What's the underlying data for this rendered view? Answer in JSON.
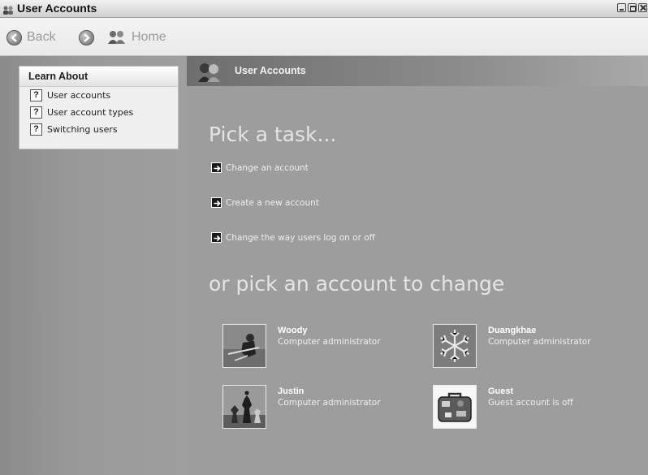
{
  "window": {
    "title": "User Accounts"
  },
  "toolbar": {
    "back_label": "Back",
    "home_label": "Home"
  },
  "learn_about": {
    "heading": "Learn About",
    "items": [
      {
        "label": "User accounts"
      },
      {
        "label": "User account types"
      },
      {
        "label": "Switching users"
      }
    ]
  },
  "main": {
    "header_title": "User Accounts",
    "pick_task_heading": "Pick a task...",
    "tasks": [
      {
        "label": "Change an account"
      },
      {
        "label": "Create a new account"
      },
      {
        "label": "Change the way users log on or off"
      }
    ],
    "pick_account_heading": "or pick an account to change",
    "accounts": [
      {
        "name": "Woody",
        "type": "Computer administrator",
        "picture": "skier-icon"
      },
      {
        "name": "Duangkhae",
        "type": "Computer administrator",
        "picture": "snowflake-icon"
      },
      {
        "name": "Justin",
        "type": "Computer administrator",
        "picture": "chess-icon"
      },
      {
        "name": "Guest",
        "type": "Guest account is off",
        "picture": "suitcase-icon"
      }
    ]
  }
}
